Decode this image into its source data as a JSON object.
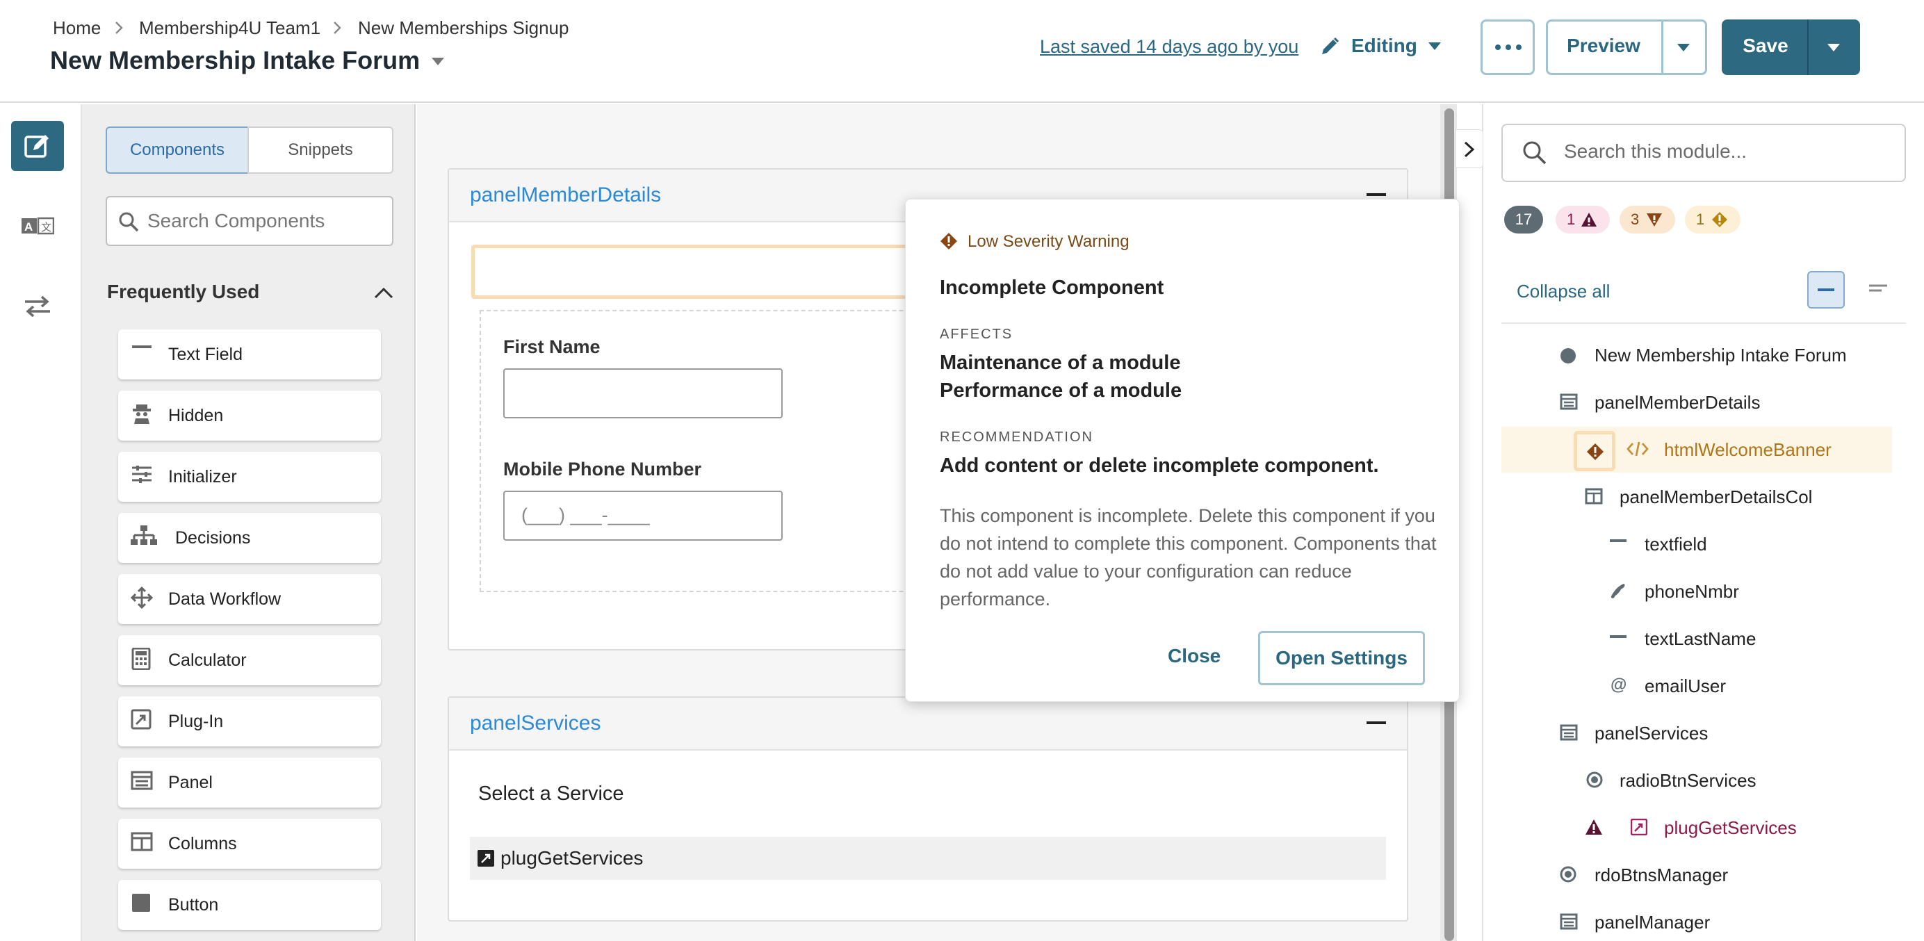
{
  "breadcrumb": [
    "Home",
    "Membership4U Team1",
    "New Memberships Signup"
  ],
  "page_title": "New Membership Intake Forum",
  "header": {
    "last_saved": "Last saved 14 days ago by you",
    "editing_label": "Editing",
    "preview_label": "Preview",
    "save_label": "Save"
  },
  "left_rail": {
    "icons": [
      "edit-icon",
      "translate-icon",
      "swap-icon"
    ]
  },
  "components_panel": {
    "tabs": [
      "Components",
      "Snippets"
    ],
    "active_tab": "Components",
    "search_placeholder": "Search Components",
    "section_title": "Frequently Used",
    "items": [
      {
        "label": "Text Field",
        "icon": "text-field-icon"
      },
      {
        "label": "Hidden",
        "icon": "hidden-icon"
      },
      {
        "label": "Initializer",
        "icon": "initializer-icon"
      },
      {
        "label": "Decisions",
        "icon": "decisions-icon"
      },
      {
        "label": "Data Workflow",
        "icon": "data-workflow-icon"
      },
      {
        "label": "Calculator",
        "icon": "calculator-icon"
      },
      {
        "label": "Plug-In",
        "icon": "plug-in-icon"
      },
      {
        "label": "Panel",
        "icon": "panel-icon"
      },
      {
        "label": "Columns",
        "icon": "columns-icon"
      },
      {
        "label": "Button",
        "icon": "button-icon"
      }
    ]
  },
  "canvas": {
    "panel1": {
      "title": "panelMemberDetails",
      "first_name_label": "First Name",
      "phone_label": "Mobile Phone Number",
      "phone_placeholder": "(___) ___-____"
    },
    "panel2": {
      "title": "panelServices",
      "select_label": "Select a Service",
      "plugin_label": "plugGetServices"
    }
  },
  "popover": {
    "severity": "Low Severity Warning",
    "title": "Incomplete Component",
    "affects_label": "AFFECTS",
    "affects": [
      "Maintenance of a module",
      "Performance of a module"
    ],
    "recommendation_label": "RECOMMENDATION",
    "recommendation": "Add content or delete incomplete component.",
    "description": "This component is incomplete. Delete this component if you do not intend to complete this component. Components that do not add value to your configuration can reduce performance.",
    "close_label": "Close",
    "open_settings_label": "Open Settings"
  },
  "right_panel": {
    "search_placeholder": "Search this module...",
    "badges": {
      "total": "17",
      "high": "1",
      "medium": "3",
      "low": "1"
    },
    "collapse_all": "Collapse all",
    "tree": [
      {
        "label": "New Membership Intake Forum",
        "icon": "form-dot-icon"
      },
      {
        "label": "panelMemberDetails",
        "icon": "panel-icon"
      },
      {
        "label": "htmlWelcomeBanner",
        "icon": "html-code-icon",
        "warning": "low"
      },
      {
        "label": "panelMemberDetailsCol",
        "icon": "columns-icon"
      },
      {
        "label": "textfield",
        "icon": "text-field-icon"
      },
      {
        "label": "phoneNmbr",
        "icon": "phone-icon"
      },
      {
        "label": "textLastName",
        "icon": "text-field-icon"
      },
      {
        "label": "emailUser",
        "icon": "at-icon"
      },
      {
        "label": "panelServices",
        "icon": "panel-icon"
      },
      {
        "label": "radioBtnServices",
        "icon": "radio-icon"
      },
      {
        "label": "plugGetServices",
        "icon": "plug-in-icon",
        "warning": "high"
      },
      {
        "label": "rdoBtnsManager",
        "icon": "radio-icon"
      },
      {
        "label": "panelManager",
        "icon": "panel-icon"
      }
    ]
  },
  "colors": {
    "primary": "#2d6a82",
    "link": "#2b8ad6",
    "low_warning": "#b8860b",
    "high_warning": "#8b1a4a",
    "medium_warning": "#a35a1a"
  }
}
